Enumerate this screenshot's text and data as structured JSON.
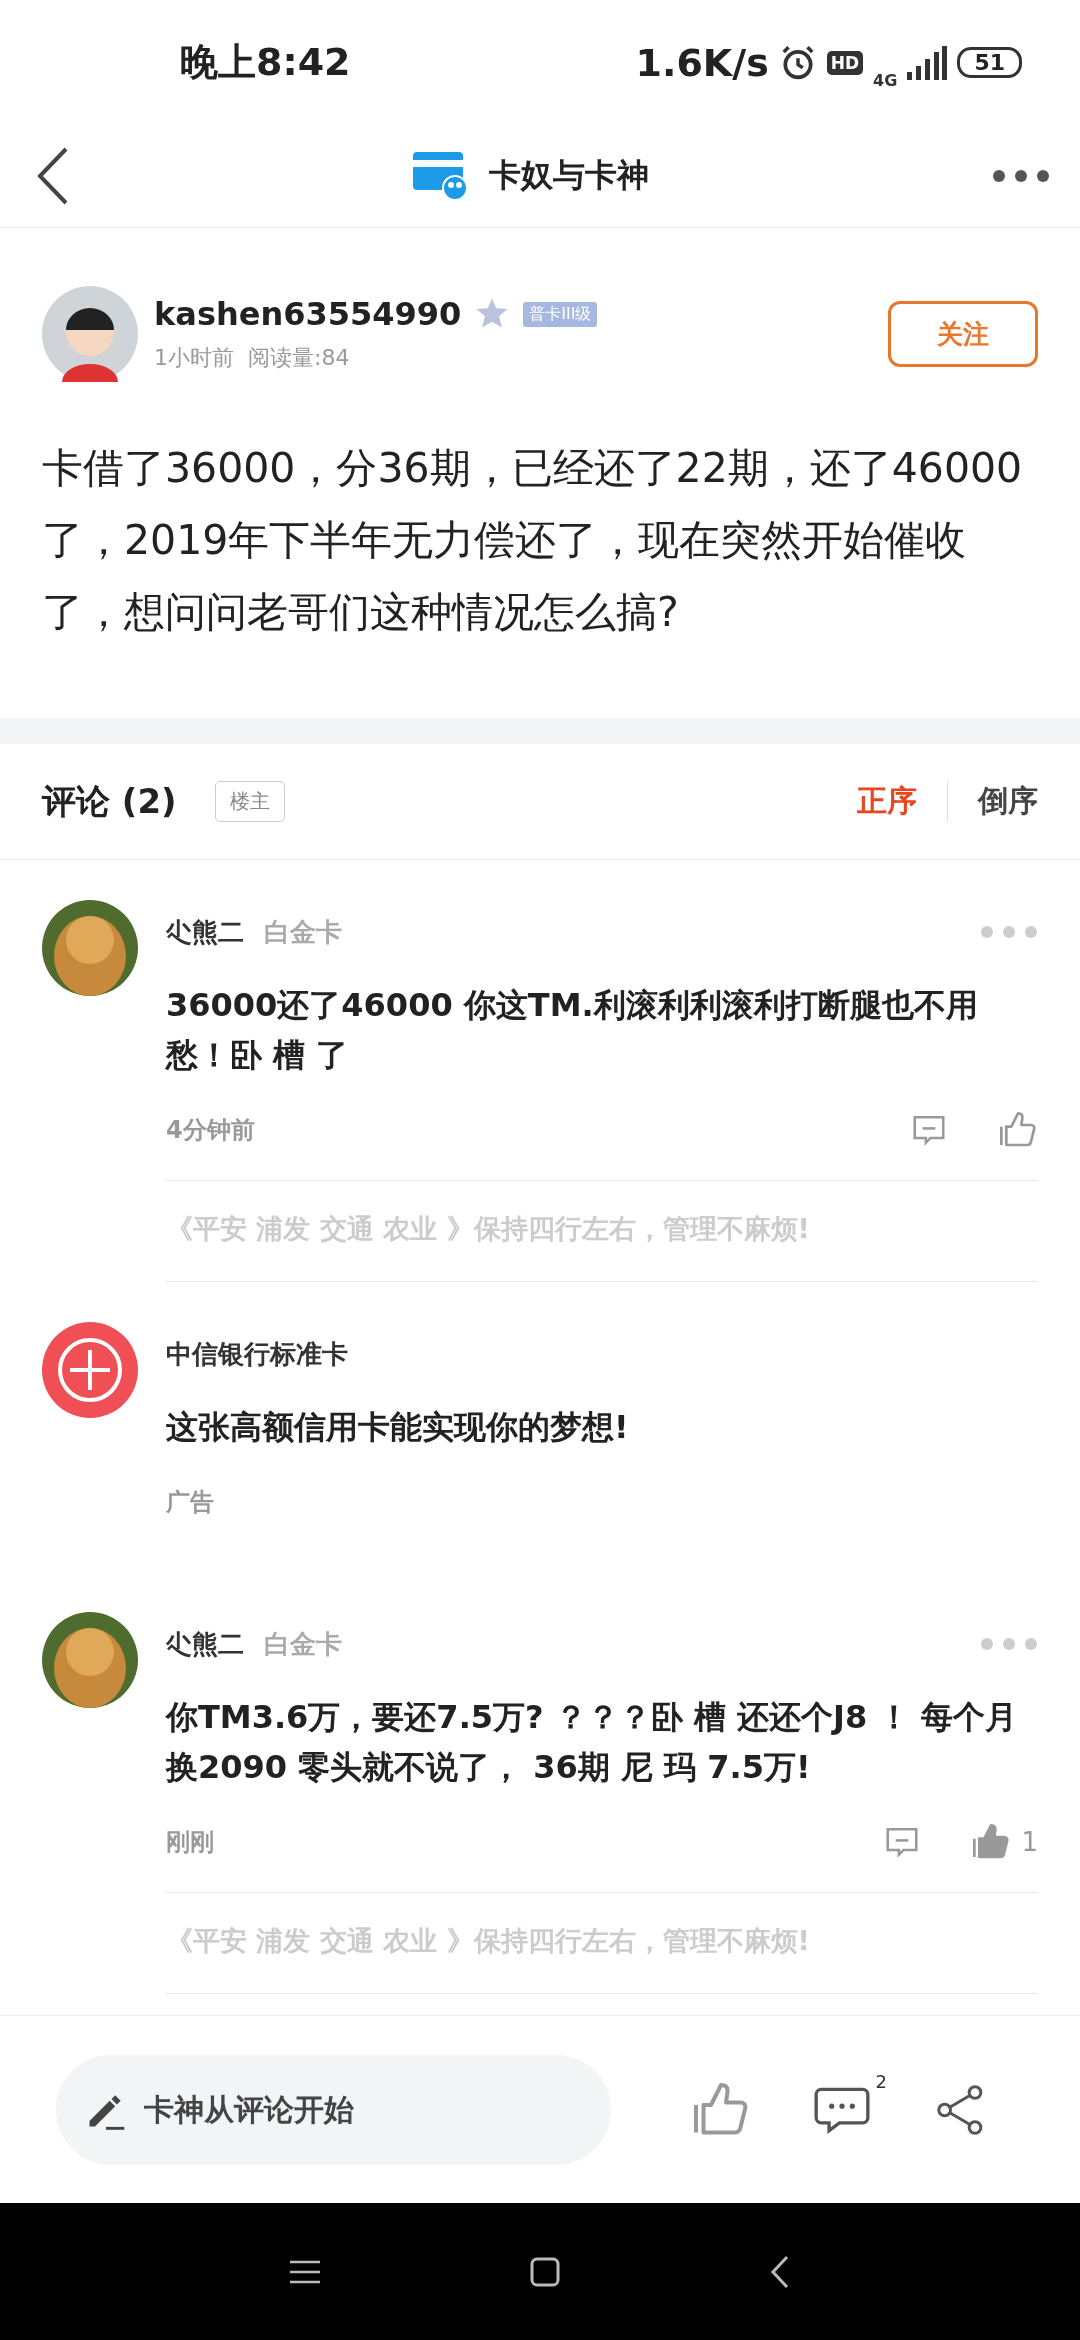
{
  "status_bar": {
    "time": "晚上8:42",
    "speed": "1.6K/s",
    "hd": "HD",
    "network": "4G",
    "battery": "51"
  },
  "header": {
    "title": "卡奴与卡神"
  },
  "author": {
    "name": "kashen63554990",
    "badge": "普卡III级",
    "time": "1小时前",
    "reads": "阅读量:84",
    "follow": "关注"
  },
  "post": {
    "body": "卡借了36000，分36期，已经还了22期，还了46000了，2019年下半年无力偿还了，现在突然开始催收了，想问问老哥们这种情况怎么搞?"
  },
  "comments_header": {
    "title": "评论 (2)",
    "tag": "楼主",
    "sort": [
      {
        "label": "正序",
        "selected": true
      },
      {
        "label": "倒序",
        "selected": false
      }
    ]
  },
  "feed": [
    {
      "kind": "comment",
      "name": "尐熊二",
      "level": "白金卡",
      "text": "36000还了46000 你这TM.利滚利利滚利打断腿也不用愁！卧 槽 了",
      "time": "4分钟前",
      "liked": false,
      "promo": "《平安 浦发 交通 农业 》保持四行左右，管理不麻烦!"
    },
    {
      "kind": "ad",
      "name": "中信银行标准卡",
      "text": "这张高额信用卡能实现你的梦想!",
      "time": "广告"
    },
    {
      "kind": "comment",
      "name": "尐熊二",
      "level": "白金卡",
      "text": "你TM3.6万，要还7.5万? ？？？卧 槽 还还个J8 ！ 每个月换2090 零头就不说了， 36期 尼 玛 7.5万!",
      "time": "刚刚",
      "liked": true,
      "likes": "1",
      "promo": "《平安 浦发 交通 农业 》保持四行左右，管理不麻烦!"
    }
  ],
  "bottom_bar": {
    "placeholder": "卡神从评论开始",
    "comment_count": "2"
  }
}
